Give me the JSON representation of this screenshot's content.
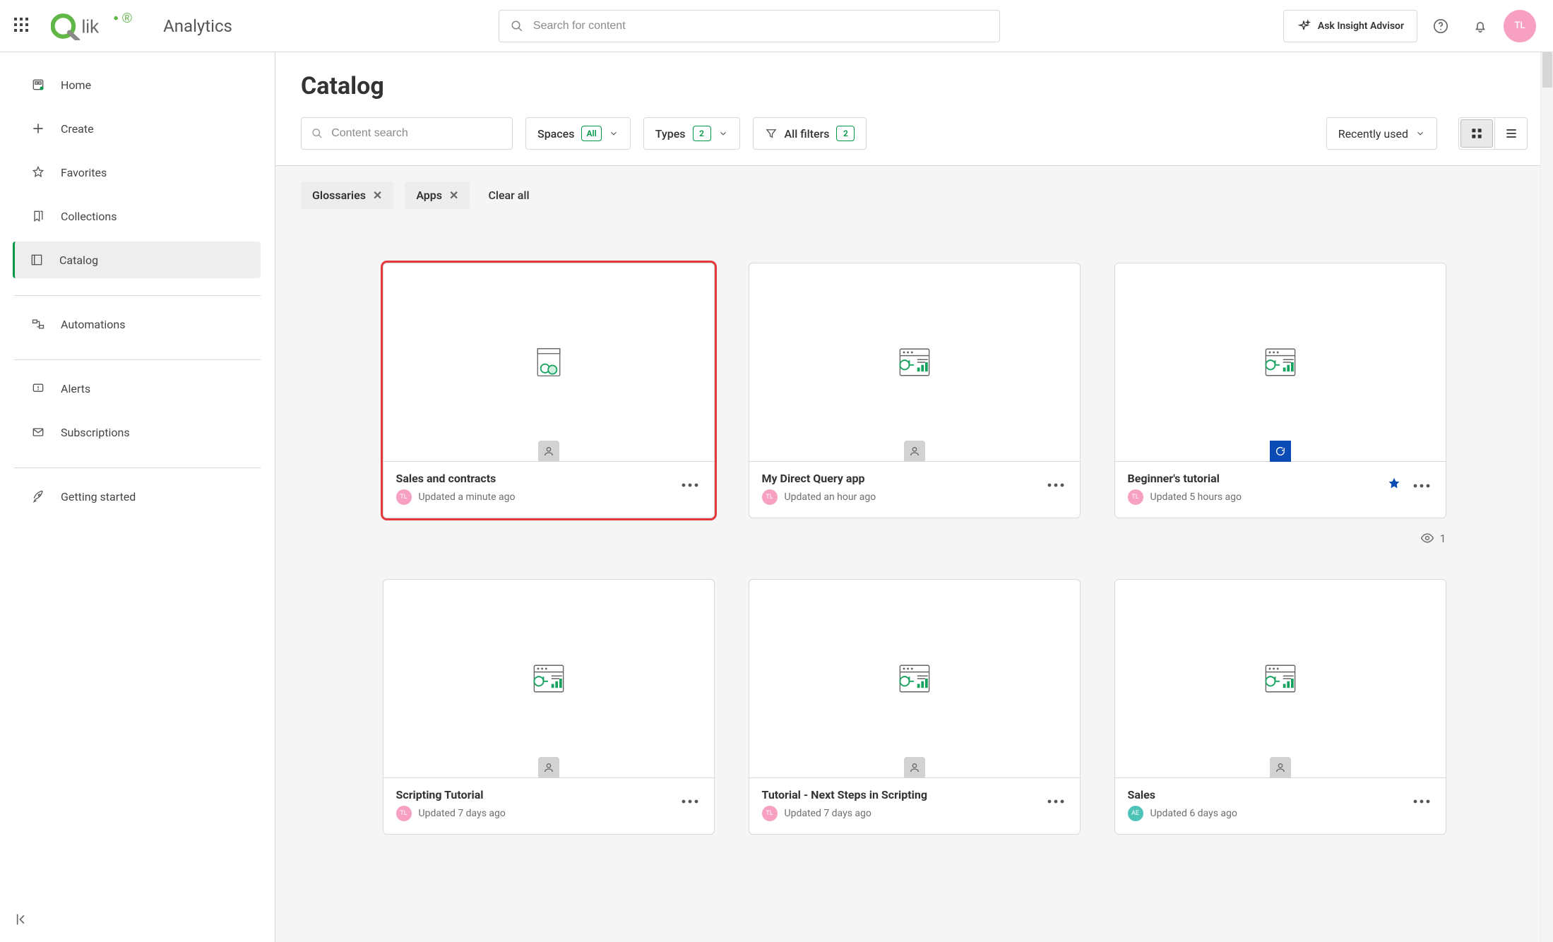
{
  "brand": {
    "hub": "Analytics"
  },
  "search": {
    "placeholder": "Search for content"
  },
  "insight": {
    "label": "Ask Insight Advisor"
  },
  "avatar": {
    "initials": "TL"
  },
  "sidebar": {
    "items": [
      {
        "label": "Home"
      },
      {
        "label": "Create"
      },
      {
        "label": "Favorites"
      },
      {
        "label": "Collections"
      },
      {
        "label": "Catalog"
      },
      {
        "label": "Automations"
      },
      {
        "label": "Alerts"
      },
      {
        "label": "Subscriptions"
      },
      {
        "label": "Getting started"
      }
    ]
  },
  "page": {
    "title": "Catalog"
  },
  "filters": {
    "content_search_placeholder": "Content search",
    "spaces": {
      "label": "Spaces",
      "badge": "All"
    },
    "types": {
      "label": "Types",
      "badge": "2"
    },
    "all": {
      "label": "All filters",
      "badge": "2"
    },
    "sort": {
      "label": "Recently used"
    }
  },
  "chips": {
    "items": [
      "Glossaries",
      "Apps"
    ],
    "clear": "Clear all"
  },
  "cards": [
    {
      "title": "Sales and contracts",
      "updated": "Updated a minute ago",
      "owner": "TL",
      "type": "glossary",
      "highlight": true,
      "favorite": false,
      "views": null
    },
    {
      "title": "My Direct Query app",
      "updated": "Updated an hour ago",
      "owner": "TL",
      "type": "app",
      "highlight": false,
      "favorite": false,
      "views": null
    },
    {
      "title": "Beginner's tutorial",
      "updated": "Updated 5 hours ago",
      "owner": "TL",
      "type": "app",
      "highlight": false,
      "favorite": true,
      "views": "1",
      "reloading": true
    },
    {
      "title": "Scripting Tutorial",
      "updated": "Updated 7 days ago",
      "owner": "TL",
      "type": "app",
      "highlight": false,
      "favorite": false,
      "views": null
    },
    {
      "title": "Tutorial - Next Steps in Scripting",
      "updated": "Updated 7 days ago",
      "owner": "TL",
      "type": "app",
      "highlight": false,
      "favorite": false,
      "views": null
    },
    {
      "title": "Sales",
      "updated": "Updated 6 days ago",
      "owner": "AE",
      "type": "app",
      "highlight": false,
      "favorite": false,
      "views": null,
      "ownerColor": "teal"
    }
  ]
}
